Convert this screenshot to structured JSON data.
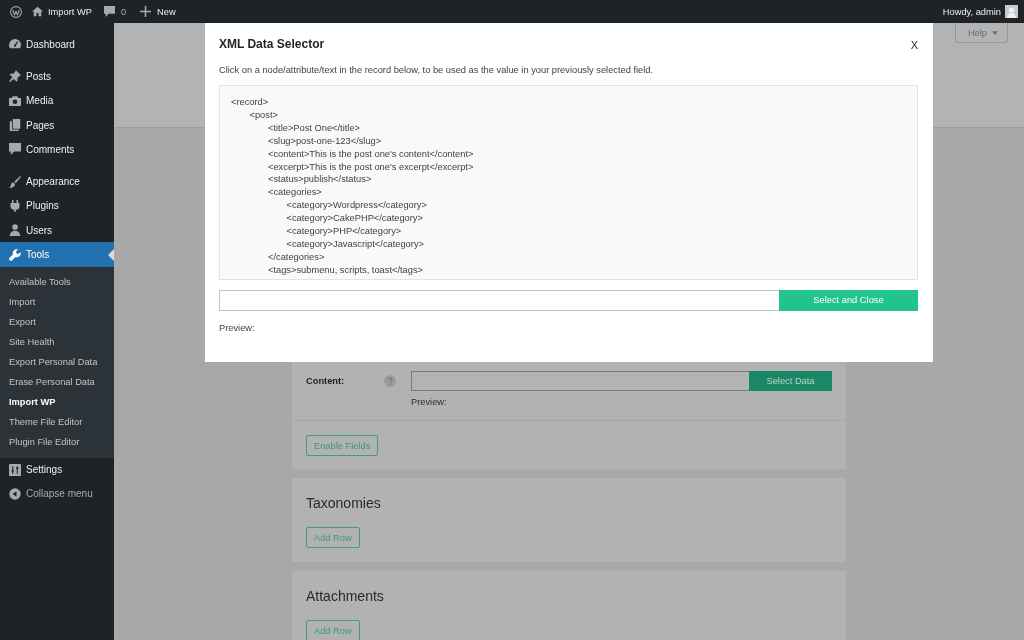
{
  "admin_bar": {
    "site_name": "Import WP",
    "comments_count": "0",
    "new_label": "New",
    "greeting": "Howdy, admin"
  },
  "sidebar": {
    "groups": [
      {
        "items": [
          {
            "label": "Dashboard",
            "selected": false
          }
        ]
      },
      {
        "items": [
          {
            "label": "Posts",
            "selected": false
          },
          {
            "label": "Media",
            "selected": false
          },
          {
            "label": "Pages",
            "selected": false
          },
          {
            "label": "Comments",
            "selected": false
          }
        ]
      },
      {
        "items": [
          {
            "label": "Appearance",
            "selected": false
          },
          {
            "label": "Plugins",
            "selected": false
          },
          {
            "label": "Users",
            "selected": false
          },
          {
            "label": "Tools",
            "selected": true,
            "submenu": [
              {
                "label": "Available Tools",
                "selected": false
              },
              {
                "label": "Import",
                "selected": false
              },
              {
                "label": "Export",
                "selected": false
              },
              {
                "label": "Site Health",
                "selected": false
              },
              {
                "label": "Export Personal Data",
                "selected": false
              },
              {
                "label": "Erase Personal Data",
                "selected": false
              },
              {
                "label": "Import WP",
                "selected": true
              },
              {
                "label": "Theme File Editor",
                "selected": false
              },
              {
                "label": "Plugin File Editor",
                "selected": false
              }
            ]
          },
          {
            "label": "Settings",
            "selected": false
          }
        ]
      }
    ],
    "collapse_label": "Collapse menu"
  },
  "help_button": {
    "label": "Help"
  },
  "panels": [
    {
      "kind": "fields",
      "fields": [
        {
          "label": "Content:",
          "button": "Select Data",
          "preview": "Preview:"
        }
      ],
      "button": "Enable Fields"
    },
    {
      "kind": "section",
      "title": "Taxonomies",
      "button": "Add Row"
    },
    {
      "kind": "section",
      "title": "Attachments",
      "button": "Add Row"
    }
  ],
  "modal": {
    "title": "XML Data Selector",
    "close": "X",
    "instructions": "Click on a node/attribute/text in the record below, to be used as the value in your previously selected field.",
    "record": [
      {
        "text": "<record>",
        "children": [
          {
            "text": "<post>",
            "children": [
              {
                "text": "<title>Post One</title>"
              },
              {
                "text": "<slug>post-one-123</slug>"
              },
              {
                "text": "<content>This is the post one's content</content>"
              },
              {
                "text": "<excerpt>This is the post one's excerpt</excerpt>"
              },
              {
                "text": "<status>publish</status>"
              },
              {
                "text": "<categories>",
                "children": [
                  {
                    "text": "<category>Wordpress</category>"
                  },
                  {
                    "text": "<category>CakePHP</category>"
                  },
                  {
                    "text": "<category>PHP</category>"
                  },
                  {
                    "text": "<category>Javascript</category>"
                  }
                ],
                "close": "</categories>"
              },
              {
                "text": "<tags>submenu, scripts, toast</tags>"
              }
            ]
          }
        ]
      }
    ],
    "button": "Select and Close",
    "preview": "Preview:"
  }
}
